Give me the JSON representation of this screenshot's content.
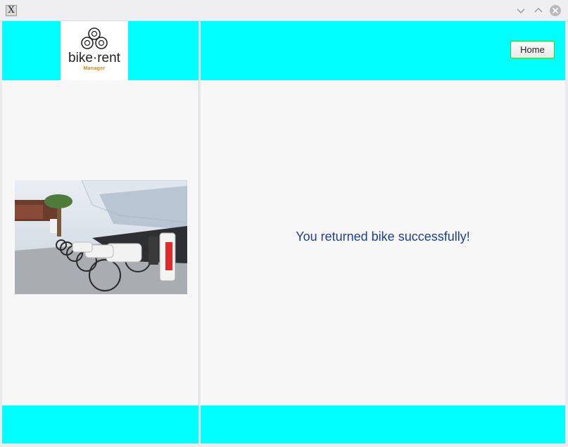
{
  "window": {
    "icon": "x11-app-icon",
    "controls": [
      "minimize-icon",
      "maximize-icon",
      "close-icon"
    ]
  },
  "logo": {
    "name": "bike·rent",
    "subtitle": "Manager"
  },
  "header": {
    "home_label": "Home"
  },
  "main": {
    "message": "You returned bike successfully!"
  },
  "colors": {
    "accent": "#00ffff",
    "message": "#1c3f8c",
    "logo_sub": "#d4851a"
  }
}
